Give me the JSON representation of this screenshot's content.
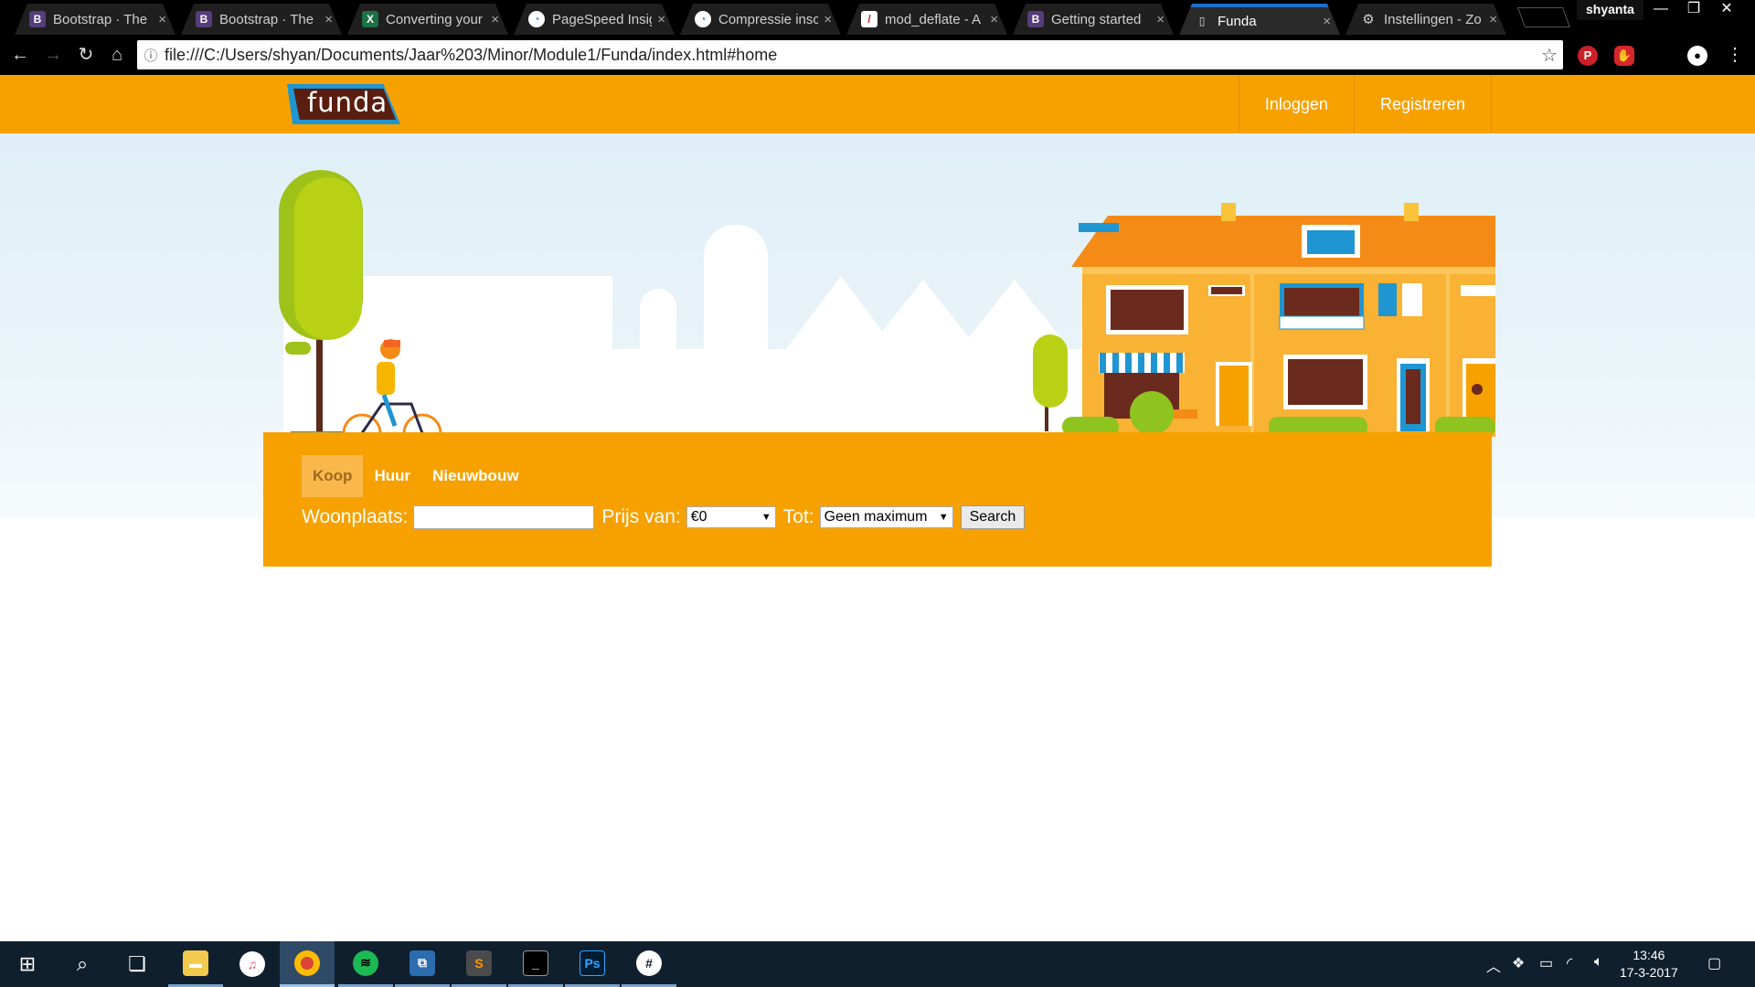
{
  "browser": {
    "tabs": [
      {
        "title": "Bootstrap · The",
        "icon": "bootstrap-icon",
        "color": "#563d7c",
        "glyph": "B"
      },
      {
        "title": "Bootstrap · The",
        "icon": "bootstrap-icon",
        "color": "#563d7c",
        "glyph": "B"
      },
      {
        "title": "Converting your",
        "icon": "excel-icon",
        "color": "#1e7145",
        "glyph": "X"
      },
      {
        "title": "PageSpeed Insig",
        "icon": "pagespeed-icon",
        "color": "#4285f4",
        "glyph": "◔"
      },
      {
        "title": "Compressie insc",
        "icon": "google-icon",
        "color": "#4285f4",
        "glyph": "◔"
      },
      {
        "title": "mod_deflate - A",
        "icon": "apache-icon",
        "color": "#c92037",
        "glyph": "/"
      },
      {
        "title": "Getting started",
        "icon": "bootstrap-icon",
        "color": "#563d7c",
        "glyph": "B"
      },
      {
        "title": "Funda",
        "icon": "page-icon",
        "color": "#2a2a2a",
        "glyph": "▯"
      },
      {
        "title": "Instellingen - Zo",
        "icon": "settings-icon",
        "color": "#2a2a2a",
        "glyph": "⚙"
      }
    ],
    "close_glyph": "×",
    "profile": "shyanta",
    "window_controls": [
      "—",
      "❐",
      "✕"
    ],
    "url": "file:///C:/Users/shyan/Documents/Jaar%203/Minor/Module1/Funda/index.html#home",
    "nav": {
      "back": "←",
      "forward": "→",
      "reload": "↻",
      "home": "⌂",
      "info": "ⓘ",
      "star": "☆",
      "menu": "⋮"
    }
  },
  "site": {
    "logo": "funda",
    "header_links": [
      "Inloggen",
      "Registreren"
    ],
    "brand_color": "#f7a100"
  },
  "search": {
    "tabs": [
      "Koop",
      "Huur",
      "Nieuwbouw"
    ],
    "active_tab": "Koop",
    "place_label": "Woonplaats:",
    "place_value": "",
    "price_from_label": "Prijs van:",
    "price_from_value": "€0",
    "price_to_label": "Tot:",
    "price_to_value": "Geen maximum",
    "button": "Search"
  },
  "taskbar": {
    "clock_time": "13:46",
    "clock_date": "17-3-2017",
    "apps": [
      "start-icon",
      "search-icon",
      "task-view-icon",
      "file-explorer-icon",
      "itunes-icon",
      "chrome-icon",
      "spotify-icon",
      "network-app-icon",
      "sublime-text-icon",
      "terminal-icon",
      "photoshop-icon",
      "slack-icon"
    ]
  }
}
